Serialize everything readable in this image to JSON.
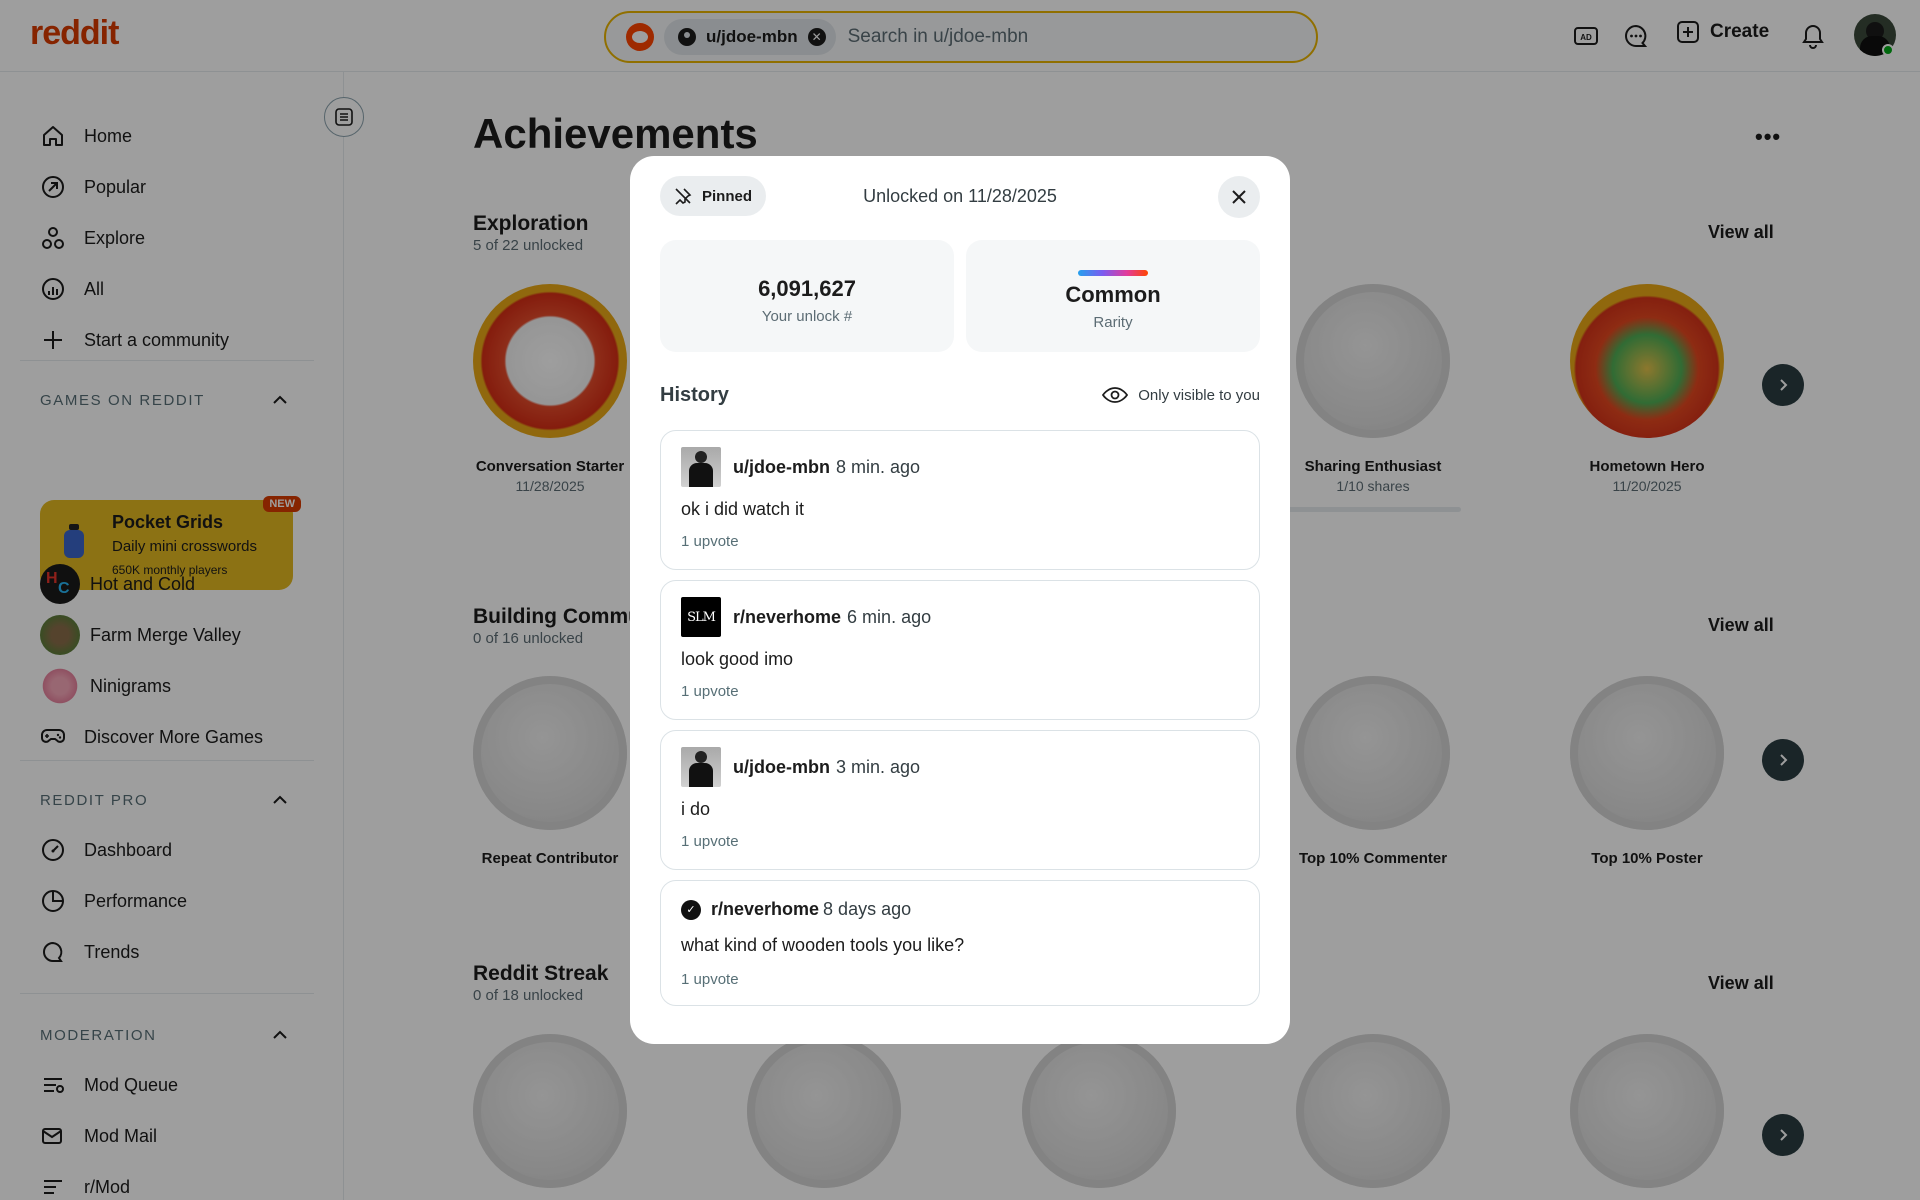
{
  "header": {
    "logo": "reddit",
    "search_chip": "u/jdoe-mbn",
    "search_placeholder": "Search in u/jdoe-mbn",
    "create_label": "Create"
  },
  "sidebar": {
    "nav": [
      {
        "label": "Home",
        "icon": "home-icon"
      },
      {
        "label": "Popular",
        "icon": "popular-icon"
      },
      {
        "label": "Explore",
        "icon": "explore-icon"
      },
      {
        "label": "All",
        "icon": "all-icon"
      },
      {
        "label": "Start a community",
        "icon": "plus-icon"
      }
    ],
    "games_title": "GAMES ON REDDIT",
    "promo": {
      "title": "Pocket Grids",
      "subtitle": "Daily mini crosswords",
      "players": "650K monthly players",
      "badge": "NEW"
    },
    "games": [
      {
        "label": "Hot and Cold"
      },
      {
        "label": "Farm Merge Valley"
      },
      {
        "label": "Ninigrams"
      },
      {
        "label": "Discover More Games"
      }
    ],
    "pro_title": "REDDIT PRO",
    "pro_items": [
      {
        "label": "Dashboard"
      },
      {
        "label": "Performance"
      },
      {
        "label": "Trends"
      }
    ],
    "mod_title": "MODERATION",
    "mod_items": [
      {
        "label": "Mod Queue"
      },
      {
        "label": "Mod Mail"
      },
      {
        "label": "r/Mod"
      }
    ]
  },
  "main": {
    "title": "Achievements",
    "sections": [
      {
        "name": "Exploration",
        "sub": "5 of 22 unlocked",
        "view_all": "View all",
        "badges": [
          {
            "label": "Conversation Starter",
            "date": "11/28/2025"
          },
          {
            "label": "Sharing Enthusiast",
            "date": "1/10 shares",
            "progress": 0.1
          },
          {
            "label": "Hometown Hero",
            "date": "11/20/2025"
          }
        ]
      },
      {
        "name": "Building Commu",
        "sub": "0 of 16 unlocked",
        "view_all": "View all",
        "badges": [
          {
            "label": "Repeat Contributor"
          },
          {
            "label": "Top 10% Commenter"
          },
          {
            "label": "Top 10% Poster"
          }
        ]
      },
      {
        "name": "Reddit Streak",
        "sub": "0 of 18 unlocked",
        "view_all": "View all"
      }
    ]
  },
  "modal": {
    "pinned_label": "Pinned",
    "unlocked_text": "Unlocked on 11/28/2025",
    "unlock_number": "6,091,627",
    "unlock_label": "Your unlock #",
    "rarity_value": "Common",
    "rarity_label": "Rarity",
    "history_title": "History",
    "visibility_text": "Only visible to you",
    "comments": [
      {
        "author": "u/jdoe-mbn",
        "time": "8 min. ago",
        "body": "ok i did watch it",
        "upvotes": "1 upvote"
      },
      {
        "author": "r/neverhome",
        "time": "6 min. ago",
        "body": "look good imo",
        "upvotes": "1 upvote",
        "thumb_text": "SLM"
      },
      {
        "author": "u/jdoe-mbn",
        "time": "3 min. ago",
        "body": "i do",
        "upvotes": "1 upvote"
      },
      {
        "author": "r/neverhome",
        "time": "8 days ago",
        "body": "what kind of wooden tools you like?",
        "upvotes": "1 upvote"
      }
    ]
  },
  "colors": {
    "brand": "#d93a00",
    "search_border": "#e8b400",
    "promo_bg": "#e3b821"
  }
}
